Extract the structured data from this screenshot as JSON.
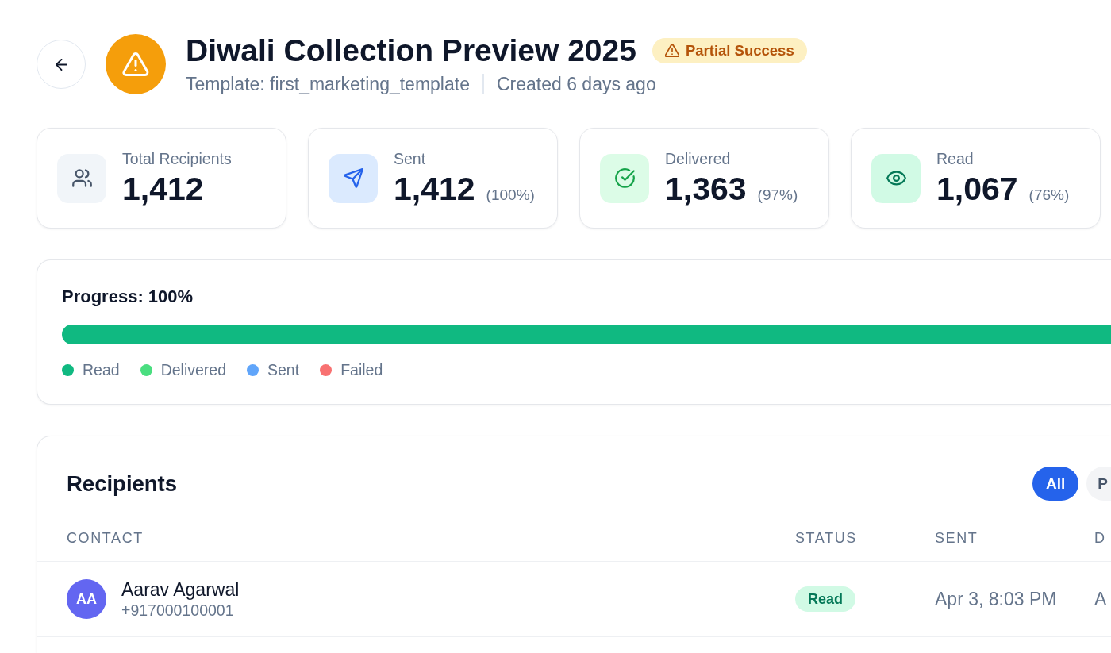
{
  "header": {
    "title": "Diwali Collection Preview 2025",
    "status": {
      "kind": "partial",
      "label": "Partial Success"
    },
    "template": "Template: first_marketing_template",
    "created": "Created 6 days ago"
  },
  "stats": [
    {
      "kind": "recipients",
      "label": "Total Recipients",
      "value": "1,412"
    },
    {
      "kind": "sent",
      "label": "Sent",
      "value": "1,412",
      "percent": "(100%)"
    },
    {
      "kind": "delivered",
      "label": "Delivered",
      "value": "1,363",
      "percent": "(97%)"
    },
    {
      "kind": "read",
      "label": "Read",
      "value": "1,067",
      "percent": "(76%)"
    }
  ],
  "progress": {
    "label": "Progress: 100%",
    "level": 1,
    "legend": [
      {
        "label": "Read",
        "color": "#10b981"
      },
      {
        "label": "Delivered",
        "color": "#4ade80"
      },
      {
        "label": "Sent",
        "color": "#60a5fa"
      },
      {
        "label": "Failed",
        "color": "#f87171"
      }
    ]
  },
  "recipients": {
    "title": "Recipients",
    "filters": [
      {
        "label": "All",
        "selected": true
      },
      {
        "label": "P",
        "selected": false
      }
    ],
    "columns": [
      "CONTACT",
      "STATUS",
      "SENT",
      "D"
    ],
    "rows": [
      {
        "initials": "AA",
        "name": "Aarav Agarwal",
        "phone": "+917000100001",
        "status": {
          "kind": "read",
          "label": "Read"
        },
        "sent": "Apr 3, 8:03 PM",
        "column_4": "A"
      }
    ]
  }
}
